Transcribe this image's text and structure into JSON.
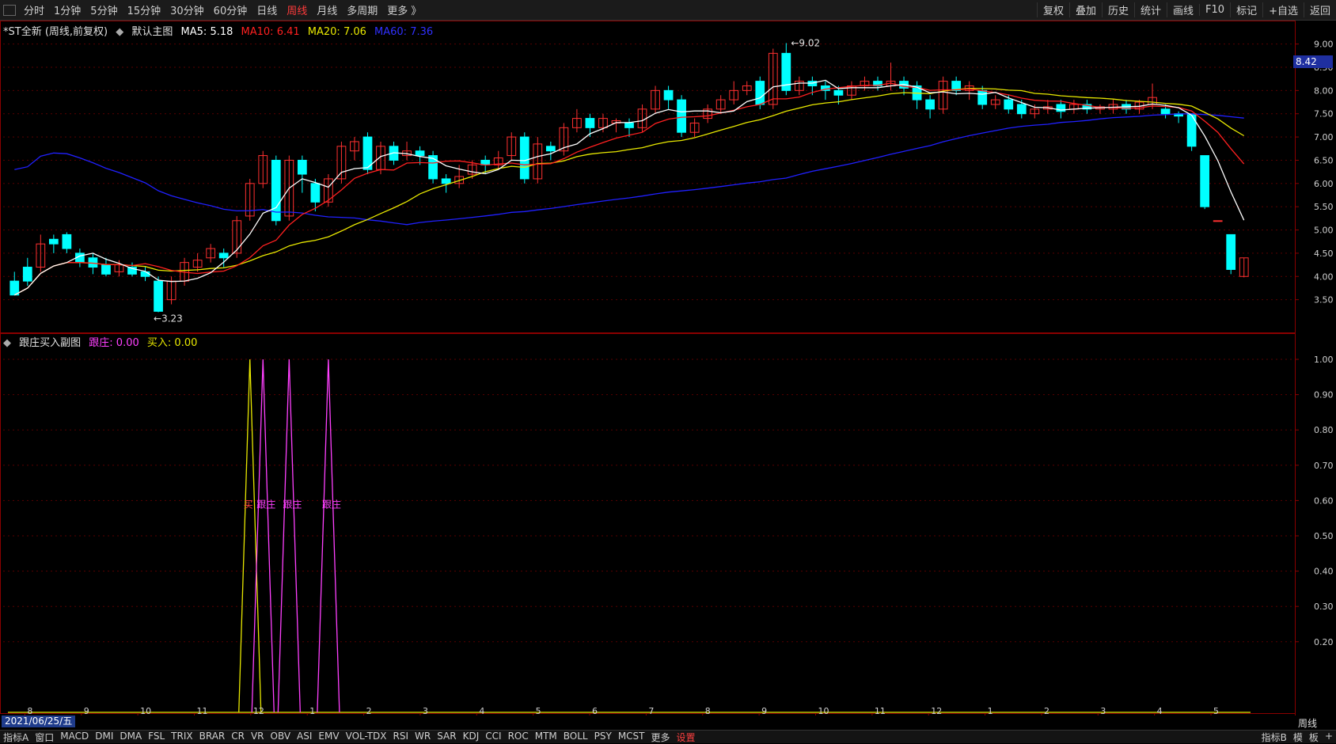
{
  "toolbar": {
    "tabs": [
      {
        "label": "分时",
        "active": false
      },
      {
        "label": "1分钟",
        "active": false
      },
      {
        "label": "5分钟",
        "active": false
      },
      {
        "label": "15分钟",
        "active": false
      },
      {
        "label": "30分钟",
        "active": false
      },
      {
        "label": "60分钟",
        "active": false
      },
      {
        "label": "日线",
        "active": false
      },
      {
        "label": "周线",
        "active": true
      },
      {
        "label": "月线",
        "active": false
      },
      {
        "label": "多周期",
        "active": false
      },
      {
        "label": "更多 》",
        "active": false
      }
    ],
    "right_buttons": [
      "复权",
      "叠加",
      "历史",
      "统计",
      "画线",
      "F10",
      "标记",
      "+自选",
      "返回"
    ]
  },
  "main_chart": {
    "title": "*ST全新 (周线,前复权)",
    "template": "默认主图",
    "ma5": {
      "label": "MA5: 5.18",
      "color": "#ffffff"
    },
    "ma10": {
      "label": "MA10: 6.41",
      "color": "#ff2020"
    },
    "ma20": {
      "label": "MA20: 7.06",
      "color": "#e8e800"
    },
    "ma60": {
      "label": "MA60: 7.36",
      "color": "#2020ff"
    },
    "high_label": "9.02",
    "low_label": "3.23",
    "current_price": "8.42",
    "price_axis": [
      "9.00",
      "8.50",
      "8.00",
      "7.50",
      "7.00",
      "6.50",
      "6.00",
      "5.50",
      "5.00",
      "4.50",
      "4.00",
      "3.50"
    ]
  },
  "sub_chart": {
    "title": "跟庄买入副图",
    "genzhuang": {
      "label": "跟庄: 0.00",
      "color": "#ff40ff"
    },
    "mairu": {
      "label": "买入: 0.00",
      "color": "#e8e800"
    },
    "axis": [
      "1.00",
      "0.90",
      "0.80",
      "0.70",
      "0.60",
      "0.50",
      "0.40",
      "0.30",
      "0.20"
    ],
    "signals": [
      {
        "type": "buy",
        "text": "买"
      },
      {
        "type": "follow",
        "text": "跟庄"
      },
      {
        "type": "follow",
        "text": "跟庄"
      },
      {
        "type": "follow",
        "text": "跟庄"
      }
    ]
  },
  "x_axis": {
    "date": "2021/06/25/五",
    "months": [
      "8",
      "9",
      "10",
      "11",
      "12",
      "1",
      "2",
      "3",
      "4",
      "5",
      "6",
      "7",
      "8",
      "9",
      "10",
      "11",
      "12",
      "1",
      "2",
      "3",
      "4",
      "5"
    ],
    "period": "周线"
  },
  "bottom_bar": {
    "items": [
      "指标A",
      "窗口",
      "MACD",
      "DMI",
      "DMA",
      "FSL",
      "TRIX",
      "BRAR",
      "CR",
      "VR",
      "OBV",
      "ASI",
      "EMV",
      "VOL-TDX",
      "RSI",
      "WR",
      "SAR",
      "KDJ",
      "CCI",
      "ROC",
      "MTM",
      "BOLL",
      "PSY",
      "MCST",
      "更多",
      "设置"
    ],
    "right": [
      "指标B",
      "模",
      "板",
      "+"
    ]
  },
  "chart_data": {
    "type": "candlestick",
    "price_range": [
      3.0,
      9.3
    ],
    "candles": [
      [
        3.9,
        3.6,
        4.1,
        3.6
      ],
      [
        4.2,
        3.9,
        4.4,
        3.8
      ],
      [
        4.2,
        4.7,
        4.9,
        4.1
      ],
      [
        4.8,
        4.7,
        4.9,
        4.5
      ],
      [
        4.9,
        4.6,
        4.95,
        4.5
      ],
      [
        4.5,
        4.3,
        4.6,
        4.2
      ],
      [
        4.4,
        4.2,
        4.5,
        4.05
      ],
      [
        4.25,
        4.05,
        4.4,
        4.0
      ],
      [
        4.1,
        4.25,
        4.35,
        4.0
      ],
      [
        4.2,
        4.05,
        4.3,
        4.0
      ],
      [
        4.1,
        4.0,
        4.2,
        3.9
      ],
      [
        3.9,
        3.25,
        4.0,
        3.23
      ],
      [
        3.5,
        3.9,
        4.0,
        3.4
      ],
      [
        3.9,
        4.3,
        4.4,
        3.8
      ],
      [
        4.2,
        4.35,
        4.5,
        4.1
      ],
      [
        4.4,
        4.6,
        4.7,
        4.3
      ],
      [
        4.5,
        4.4,
        4.6,
        4.2
      ],
      [
        4.5,
        5.2,
        5.3,
        4.4
      ],
      [
        5.3,
        6.0,
        6.1,
        5.2
      ],
      [
        6.0,
        6.6,
        6.7,
        5.9
      ],
      [
        6.5,
        5.2,
        6.6,
        5.1
      ],
      [
        5.3,
        6.5,
        6.6,
        5.2
      ],
      [
        6.5,
        6.2,
        6.6,
        5.8
      ],
      [
        6.0,
        5.6,
        6.1,
        5.4
      ],
      [
        5.6,
        6.1,
        6.2,
        5.5
      ],
      [
        6.1,
        6.8,
        6.9,
        6.0
      ],
      [
        6.7,
        6.9,
        7.0,
        6.5
      ],
      [
        7.0,
        6.3,
        7.1,
        6.2
      ],
      [
        6.3,
        6.8,
        6.9,
        6.2
      ],
      [
        6.8,
        6.5,
        6.9,
        6.4
      ],
      [
        6.6,
        6.7,
        6.9,
        6.5
      ],
      [
        6.7,
        6.6,
        6.8,
        6.4
      ],
      [
        6.6,
        6.1,
        6.7,
        6.0
      ],
      [
        6.1,
        6.0,
        6.2,
        5.8
      ],
      [
        6.0,
        6.15,
        6.4,
        5.9
      ],
      [
        6.2,
        6.4,
        6.5,
        6.1
      ],
      [
        6.5,
        6.4,
        6.6,
        6.2
      ],
      [
        6.4,
        6.55,
        6.7,
        6.3
      ],
      [
        6.6,
        7.0,
        7.1,
        6.5
      ],
      [
        7.0,
        6.1,
        7.1,
        6.0
      ],
      [
        6.1,
        6.85,
        7.0,
        6.0
      ],
      [
        6.8,
        6.7,
        6.9,
        6.5
      ],
      [
        6.7,
        7.2,
        7.3,
        6.6
      ],
      [
        7.2,
        7.4,
        7.6,
        7.1
      ],
      [
        7.4,
        7.2,
        7.5,
        7.0
      ],
      [
        7.2,
        7.4,
        7.5,
        7.1
      ],
      [
        7.3,
        7.35,
        7.4,
        7.1
      ],
      [
        7.3,
        7.2,
        7.4,
        7.0
      ],
      [
        7.2,
        7.6,
        7.7,
        7.1
      ],
      [
        7.6,
        8.0,
        8.1,
        7.5
      ],
      [
        8.0,
        7.8,
        8.1,
        7.6
      ],
      [
        7.8,
        7.1,
        7.9,
        7.0
      ],
      [
        7.1,
        7.3,
        7.4,
        7.0
      ],
      [
        7.4,
        7.6,
        7.7,
        7.3
      ],
      [
        7.6,
        7.8,
        7.9,
        7.5
      ],
      [
        7.8,
        8.0,
        8.2,
        7.7
      ],
      [
        8.0,
        8.1,
        8.2,
        7.9
      ],
      [
        8.2,
        7.7,
        8.3,
        7.6
      ],
      [
        7.7,
        8.8,
        8.9,
        7.6
      ],
      [
        8.8,
        8.0,
        9.02,
        7.9
      ],
      [
        8.0,
        8.2,
        8.3,
        7.9
      ],
      [
        8.2,
        8.1,
        8.3,
        7.9
      ],
      [
        8.1,
        8.0,
        8.2,
        7.8
      ],
      [
        8.0,
        7.9,
        8.1,
        7.7
      ],
      [
        7.9,
        8.1,
        8.2,
        7.8
      ],
      [
        8.1,
        8.2,
        8.3,
        8.0
      ],
      [
        8.2,
        8.1,
        8.3,
        8.0
      ],
      [
        8.1,
        8.2,
        8.6,
        8.0
      ],
      [
        8.2,
        8.05,
        8.3,
        7.9
      ],
      [
        8.1,
        7.8,
        8.2,
        7.6
      ],
      [
        7.8,
        7.6,
        7.9,
        7.4
      ],
      [
        7.6,
        8.2,
        8.3,
        7.5
      ],
      [
        8.2,
        8.0,
        8.3,
        7.9
      ],
      [
        8.0,
        8.1,
        8.2,
        7.8
      ],
      [
        8.0,
        7.7,
        8.1,
        7.6
      ],
      [
        7.7,
        7.8,
        7.9,
        7.6
      ],
      [
        7.8,
        7.6,
        7.9,
        7.5
      ],
      [
        7.7,
        7.5,
        7.8,
        7.4
      ],
      [
        7.5,
        7.6,
        7.7,
        7.4
      ],
      [
        7.6,
        7.65,
        7.8,
        7.5
      ],
      [
        7.7,
        7.55,
        7.8,
        7.4
      ],
      [
        7.6,
        7.7,
        7.8,
        7.5
      ],
      [
        7.7,
        7.6,
        7.8,
        7.5
      ],
      [
        7.6,
        7.65,
        7.7,
        7.5
      ],
      [
        7.6,
        7.7,
        7.8,
        7.5
      ],
      [
        7.7,
        7.6,
        7.8,
        7.5
      ],
      [
        7.6,
        7.75,
        7.8,
        7.5
      ],
      [
        7.7,
        7.85,
        8.15,
        7.6
      ],
      [
        7.6,
        7.5,
        7.7,
        7.4
      ],
      [
        7.5,
        7.45,
        7.55,
        7.3
      ],
      [
        7.5,
        6.8,
        7.5,
        6.7
      ],
      [
        6.6,
        5.5,
        6.6,
        5.45
      ],
      [
        5.2,
        5.2,
        5.2,
        5.2
      ],
      [
        4.9,
        4.15,
        4.9,
        4.05
      ],
      [
        4.0,
        4.4,
        4.4,
        3.98
      ]
    ]
  }
}
